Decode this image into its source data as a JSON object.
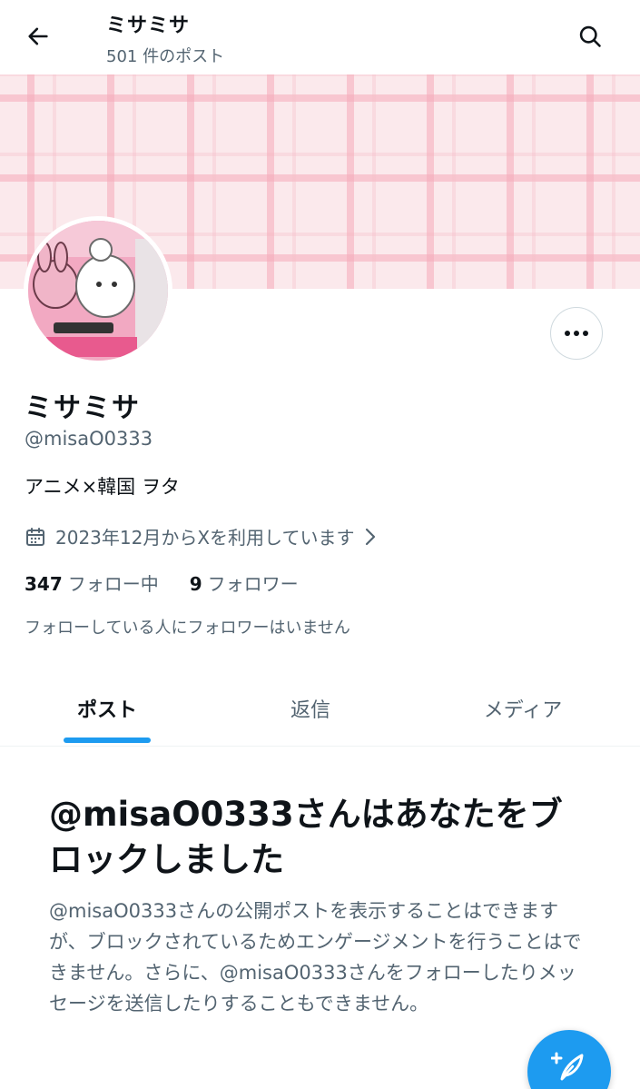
{
  "header": {
    "title": "ミサミサ",
    "post_count": "501 件のポスト"
  },
  "icons": {
    "back": "arrow-left-icon",
    "search": "search-icon",
    "more": "more-horizontal-icon",
    "calendar": "calendar-icon",
    "chevron": "chevron-right-icon",
    "compose": "compose-post-icon"
  },
  "profile": {
    "display_name": "ミサミサ",
    "handle": "@misaO0333",
    "bio": "アニメ×韓国 ヲタ",
    "joined": "2023年12月からXを利用しています",
    "following_count": "347",
    "following_label": "フォロー中",
    "followers_count": "9",
    "followers_label": "フォロワー",
    "no_mutual_followers": "フォローしている人にフォロワーはいません"
  },
  "tabs": [
    {
      "label": "ポスト",
      "active": true
    },
    {
      "label": "返信",
      "active": false
    },
    {
      "label": "メディア",
      "active": false
    }
  ],
  "blocked": {
    "title": "@misaO0333さんはあなたをブロックしました",
    "description": "@misaO0333さんの公開ポストを表示することはできますが、ブロックされているためエンゲージメントを行うことはできません。さらに、@misaO0333さんをフォローしたりメッセージを送信したりすることもできません。"
  },
  "colors": {
    "accent": "#1d9bf0",
    "text_primary": "#0f1419",
    "text_secondary": "#536471",
    "banner": "#fbe9ec"
  }
}
